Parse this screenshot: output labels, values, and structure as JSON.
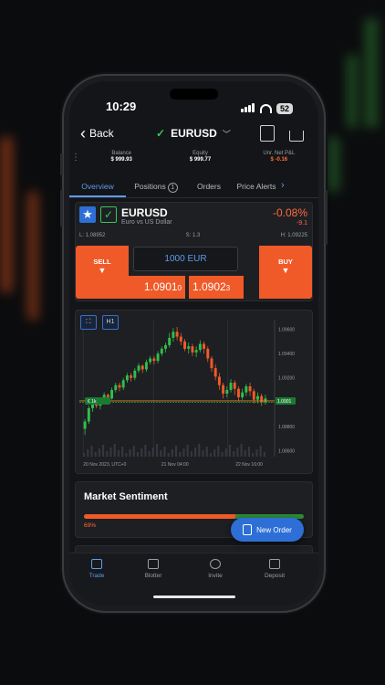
{
  "status": {
    "time": "10:29",
    "battery": "52"
  },
  "nav": {
    "back_label": "Back",
    "symbol": "EURUSD"
  },
  "account": {
    "balance_label": "Balance",
    "balance_value": "$ 999.93",
    "equity_label": "Equity",
    "equity_value": "$ 999.77",
    "pnl_label": "Unr. Net P&L",
    "pnl_value": "$ -0.16"
  },
  "tabs": [
    {
      "label": "Overview"
    },
    {
      "label": "Positions",
      "badge": "1"
    },
    {
      "label": "Orders"
    },
    {
      "label": "Price Alerts"
    }
  ],
  "quote": {
    "symbol": "EURUSD",
    "name": "Euro vs US Dollar",
    "change_pct": "-0.08%",
    "change_pts": "-9.1",
    "low": "L: 1.08952",
    "spread": "S: 1.3",
    "high": "H: 1.09225",
    "sell_label": "SELL",
    "buy_label": "BUY",
    "quantity": "1000 EUR",
    "bid_main": "1.0901",
    "bid_pip": "0",
    "ask_main": "1.0902",
    "ask_pip": "3"
  },
  "chart_data": {
    "type": "candlestick",
    "timeframe": "H1",
    "ylim": [
      1.0855,
      1.0968
    ],
    "y_ticks": [
      "1.09600",
      "1.09400",
      "1.09200",
      "1.09000",
      "1.08800",
      "1.08600"
    ],
    "y_tick_values": [
      1.096,
      1.094,
      1.092,
      1.09,
      1.088,
      1.086
    ],
    "x_ticks": [
      "20 Nov 2023, UTC+0",
      "21 Nov 04:00",
      "22 Nov 16:00"
    ],
    "current_price": "1.0901",
    "position_marker": "€ 1k",
    "candles": [
      [
        1.0878,
        1.0884,
        1.0873,
        1.0886
      ],
      [
        1.0884,
        1.0895,
        1.0882,
        1.0897
      ],
      [
        1.0895,
        1.0899,
        1.0892,
        1.0901
      ],
      [
        1.0899,
        1.0897,
        1.0895,
        1.0902
      ],
      [
        1.0897,
        1.0902,
        1.0894,
        1.0904
      ],
      [
        1.0902,
        1.0906,
        1.09,
        1.0908
      ],
      [
        1.0906,
        1.0903,
        1.0901,
        1.0907
      ],
      [
        1.0903,
        1.091,
        1.0902,
        1.0912
      ],
      [
        1.091,
        1.0914,
        1.0908,
        1.0916
      ],
      [
        1.0914,
        1.0912,
        1.0909,
        1.0916
      ],
      [
        1.0912,
        1.0918,
        1.091,
        1.092
      ],
      [
        1.0918,
        1.0922,
        1.0916,
        1.0924
      ],
      [
        1.0922,
        1.092,
        1.0917,
        1.0924
      ],
      [
        1.092,
        1.0926,
        1.0918,
        1.0928
      ],
      [
        1.0926,
        1.093,
        1.0924,
        1.0932
      ],
      [
        1.093,
        1.0927,
        1.0924,
        1.0931
      ],
      [
        1.0927,
        1.0933,
        1.0925,
        1.0935
      ],
      [
        1.0933,
        1.0936,
        1.0931,
        1.0938
      ],
      [
        1.0936,
        1.0934,
        1.0931,
        1.0938
      ],
      [
        1.0934,
        1.094,
        1.0932,
        1.0942
      ],
      [
        1.094,
        1.0944,
        1.0938,
        1.0946
      ],
      [
        1.0944,
        1.0947,
        1.0941,
        1.0949
      ],
      [
        1.0947,
        1.0953,
        1.0945,
        1.0957
      ],
      [
        1.0953,
        1.0958,
        1.095,
        1.0961
      ],
      [
        1.0958,
        1.0954,
        1.0951,
        1.0962
      ],
      [
        1.0954,
        1.095,
        1.0947,
        1.0957
      ],
      [
        1.095,
        1.0944,
        1.0942,
        1.0952
      ],
      [
        1.0944,
        1.0946,
        1.094,
        1.0949
      ],
      [
        1.0946,
        1.0941,
        1.0938,
        1.0948
      ],
      [
        1.0941,
        1.0943,
        1.0937,
        1.0946
      ],
      [
        1.0943,
        1.0948,
        1.0941,
        1.0951
      ],
      [
        1.0948,
        1.0944,
        1.094,
        1.095
      ],
      [
        1.0944,
        1.0936,
        1.0933,
        1.0946
      ],
      [
        1.0936,
        1.0928,
        1.0925,
        1.0938
      ],
      [
        1.0928,
        1.0921,
        1.0918,
        1.0931
      ],
      [
        1.0921,
        1.0914,
        1.091,
        1.0924
      ],
      [
        1.0914,
        1.0907,
        1.0903,
        1.0916
      ],
      [
        1.0907,
        1.091,
        1.0904,
        1.0913
      ],
      [
        1.091,
        1.0916,
        1.0908,
        1.0919
      ],
      [
        1.0916,
        1.0911,
        1.0906,
        1.0918
      ],
      [
        1.0911,
        1.0904,
        1.0901,
        1.0913
      ],
      [
        1.0904,
        1.0908,
        1.0902,
        1.0911
      ],
      [
        1.0908,
        1.0913,
        1.0905,
        1.0915
      ],
      [
        1.0913,
        1.0909,
        1.0905,
        1.0916
      ],
      [
        1.0909,
        1.0902,
        1.0899,
        1.0911
      ],
      [
        1.0902,
        1.0905,
        1.0899,
        1.0908
      ],
      [
        1.0905,
        1.09,
        1.0897,
        1.0907
      ],
      [
        1.09,
        1.0903,
        1.0898,
        1.0906
      ]
    ]
  },
  "sentiment": {
    "title": "Market Sentiment",
    "sell_pct_label": "69%",
    "sell_fraction": 0.69
  },
  "fab": {
    "label": "New Order"
  },
  "bottom_tabs": [
    {
      "label": "Trade"
    },
    {
      "label": "Blotter"
    },
    {
      "label": "Invite"
    },
    {
      "label": "Deposit"
    }
  ],
  "colors": {
    "accent": "#2d6fd6",
    "sell": "#f05a28",
    "buy": "#34c759",
    "negative": "#ff6b3d"
  }
}
